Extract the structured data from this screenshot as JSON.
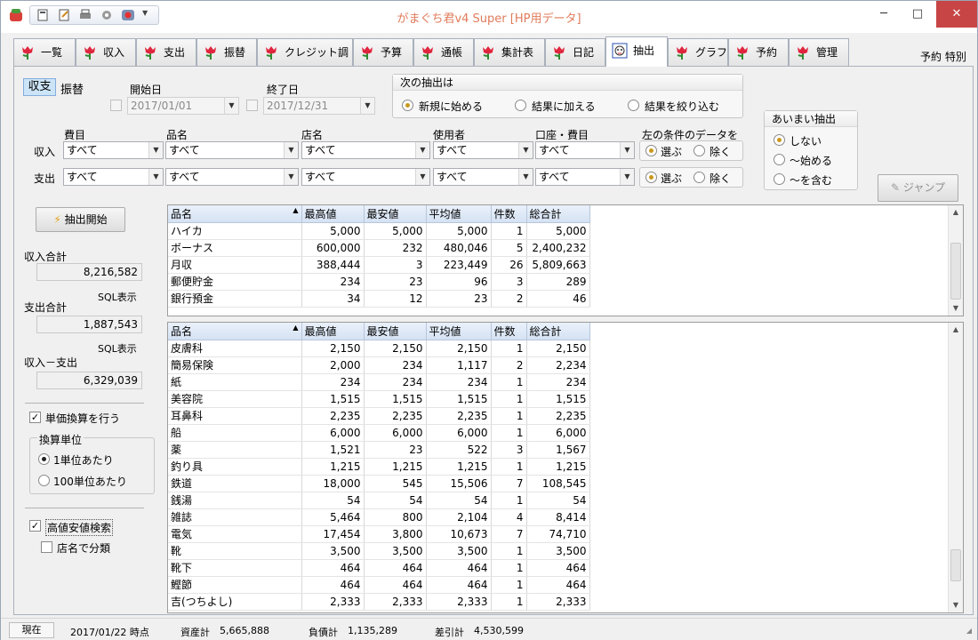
{
  "window": {
    "title": "がまぐち君v4 Super  [HP用データ]",
    "min": "─",
    "max": "□",
    "close": "✕"
  },
  "tabs": [
    "一覧",
    "収入",
    "支出",
    "振替",
    "クレジット調整",
    "予算",
    "通帳",
    "集計表",
    "日記",
    "抽出",
    "グラフ",
    "予約",
    "管理"
  ],
  "active_tab": "抽出",
  "tab_right": "予約  特別",
  "mode": {
    "kinds": [
      "収支",
      "振替"
    ],
    "selected": "収支"
  },
  "date_range": {
    "start_label": "開始日",
    "start_value": "2017/01/01",
    "end_label": "終了日",
    "end_value": "2017/12/31"
  },
  "next_extract": {
    "title": "次の抽出は",
    "options": [
      "新規に始める",
      "結果に加える",
      "結果を絞り込む"
    ],
    "selected": 0
  },
  "fuzzy": {
    "title": "あいまい抽出",
    "options": [
      "しない",
      "～始める",
      "～を含む"
    ],
    "selected": 0
  },
  "filters": {
    "headers": [
      "費目",
      "品名",
      "店名",
      "使用者",
      "口座・費目",
      "左の条件のデータを"
    ],
    "rows": [
      {
        "label": "収入",
        "values": [
          "すべて",
          "すべて",
          "すべて",
          "すべて",
          "すべて"
        ],
        "choices": [
          "選ぶ",
          "除く"
        ],
        "selected": 0
      },
      {
        "label": "支出",
        "values": [
          "すべて",
          "すべて",
          "すべて",
          "すべて",
          "すべて"
        ],
        "choices": [
          "選ぶ",
          "除く"
        ],
        "selected": 0
      }
    ]
  },
  "jump_button": "ジャンプ",
  "start_button": "抽出開始",
  "summary": {
    "income_label": "収入合計",
    "income_value": "8,216,582",
    "sql1": "SQL表示",
    "expense_label": "支出合計",
    "expense_value": "1,887,543",
    "sql2": "SQL表示",
    "diff_label": "収入－支出",
    "diff_value": "6,329,039"
  },
  "unit_conv": {
    "check_label": "単価換算を行う",
    "checked": true,
    "unit_title": "換算単位",
    "options": [
      "1単位あたり",
      "100単位あたり"
    ],
    "selected": 0
  },
  "highlow": {
    "check_label": "高値安値検索",
    "checked": true,
    "shop_label": "店名で分類",
    "shop_checked": false
  },
  "income_table": {
    "columns": [
      "品名",
      "最高値",
      "最安値",
      "平均値",
      "件数",
      "総合計"
    ],
    "rows": [
      [
        "ハイカ",
        "5,000",
        "5,000",
        "5,000",
        "1",
        "5,000"
      ],
      [
        "ボーナス",
        "600,000",
        "232",
        "480,046",
        "5",
        "2,400,232"
      ],
      [
        "月収",
        "388,444",
        "3",
        "223,449",
        "26",
        "5,809,663"
      ],
      [
        "郵便貯金",
        "234",
        "23",
        "96",
        "3",
        "289"
      ],
      [
        "銀行預金",
        "34",
        "12",
        "23",
        "2",
        "46"
      ]
    ]
  },
  "expense_table": {
    "columns": [
      "品名",
      "最高値",
      "最安値",
      "平均値",
      "件数",
      "総合計"
    ],
    "rows": [
      [
        "皮膚科",
        "2,150",
        "2,150",
        "2,150",
        "1",
        "2,150"
      ],
      [
        "簡易保険",
        "2,000",
        "234",
        "1,117",
        "2",
        "2,234"
      ],
      [
        "紙",
        "234",
        "234",
        "234",
        "1",
        "234"
      ],
      [
        "美容院",
        "1,515",
        "1,515",
        "1,515",
        "1",
        "1,515"
      ],
      [
        "耳鼻科",
        "2,235",
        "2,235",
        "2,235",
        "1",
        "2,235"
      ],
      [
        "船",
        "6,000",
        "6,000",
        "6,000",
        "1",
        "6,000"
      ],
      [
        "薬",
        "1,521",
        "23",
        "522",
        "3",
        "1,567"
      ],
      [
        "釣り具",
        "1,215",
        "1,215",
        "1,215",
        "1",
        "1,215"
      ],
      [
        "鉄道",
        "18,000",
        "545",
        "15,506",
        "7",
        "108,545"
      ],
      [
        "銭湯",
        "54",
        "54",
        "54",
        "1",
        "54"
      ],
      [
        "雑誌",
        "5,464",
        "800",
        "2,104",
        "4",
        "8,414"
      ],
      [
        "電気",
        "17,454",
        "3,800",
        "10,673",
        "7",
        "74,710"
      ],
      [
        "靴",
        "3,500",
        "3,500",
        "3,500",
        "1",
        "3,500"
      ],
      [
        "靴下",
        "464",
        "464",
        "464",
        "1",
        "464"
      ],
      [
        "鰹節",
        "464",
        "464",
        "464",
        "1",
        "464"
      ],
      [
        "吉(つちよし)",
        "2,333",
        "2,333",
        "2,333",
        "1",
        "2,333"
      ]
    ]
  },
  "statusbar": {
    "now": "現在",
    "date": "2017/01/22 時点",
    "assets_label": "資産計",
    "assets": "5,665,888",
    "liab_label": "負債計",
    "liab": "1,135,289",
    "net_label": "差引計",
    "net": "4,530,599"
  },
  "colors": {
    "title": "#e07b5a",
    "grid_header": "#d5e2f3",
    "selected_mode": "#cce4f7"
  }
}
